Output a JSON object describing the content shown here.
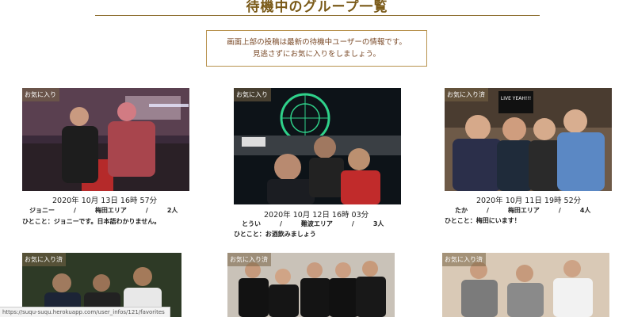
{
  "header": {
    "title": "待機中のグループ一覧"
  },
  "notice": {
    "line1": "画面上部の投稿は最新の待機中ユーザーの情報です。",
    "line2": "見逃さずにお気に入りをしましょう。"
  },
  "cards": [
    {
      "favorite_label": "お気に入り",
      "date": "2020年 10月 13日 16時 57分",
      "info": "ジョニー　　　/　　　梅田エリア　　　/　　　2人",
      "comment": "ひとこと：ジョニーです。日本語わかりません。"
    },
    {
      "favorite_label": "お気に入り",
      "date": "2020年 10月 12日 16時 03分",
      "info": "とうい　　　/　　　難波エリア　　　/　　　3人",
      "comment": "ひとこと：お酒飲みましょう"
    },
    {
      "favorite_label": "お気に入り済",
      "date": "2020年 10月 11日 19時 52分",
      "info": "たか　　　/　　　梅田エリア　　　/　　　4人",
      "comment": "ひとこと：梅田にいます！"
    },
    {
      "favorite_label": "お気に入り済"
    },
    {
      "favorite_label": "お気に入り済"
    },
    {
      "favorite_label": "お気に入り済"
    }
  ],
  "status_bar": {
    "url": "https://suqu-suqu.herokuapp.com/user_infos/121/favorites"
  },
  "photo_texts": {
    "sign_text": "LIVE YEAH!!!"
  },
  "colors": {
    "accent_brown": "#7a5a18",
    "badge_bg": "rgba(120,100,70,0.55)"
  }
}
